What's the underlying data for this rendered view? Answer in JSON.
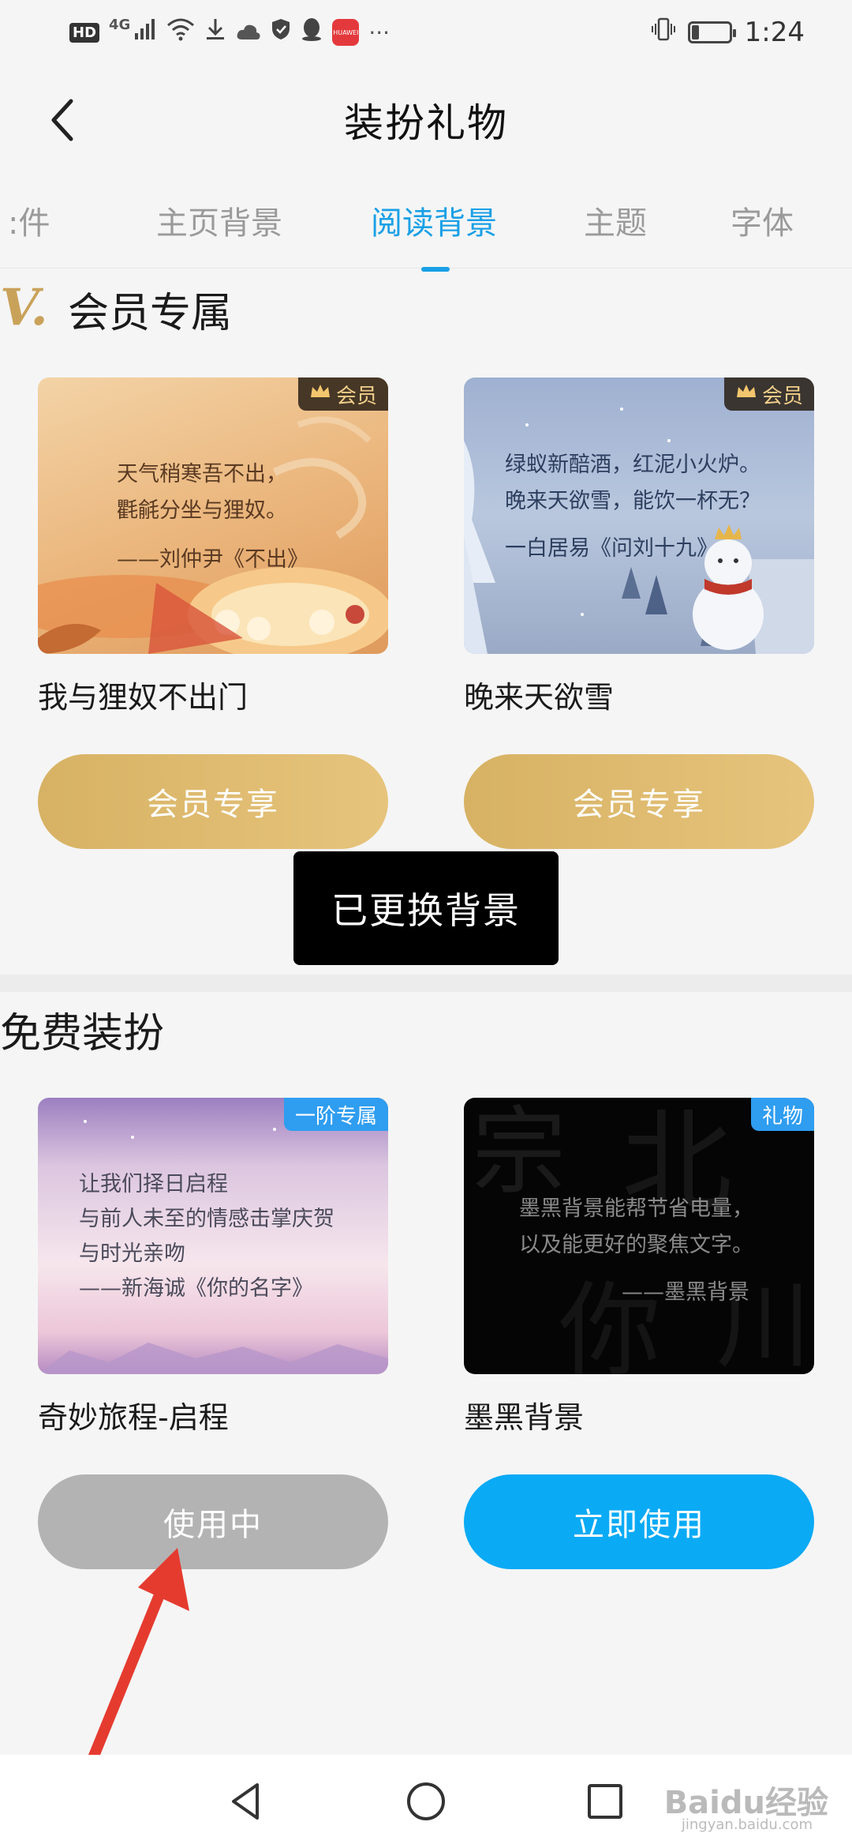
{
  "status_bar": {
    "hd": "HD",
    "network": "4G",
    "huawei_badge": "HUAWEI",
    "more": "···",
    "time": "1:24",
    "battery_level": 0.2
  },
  "header": {
    "title": "装扮礼物"
  },
  "tabs": [
    {
      "label": "挂件",
      "visible_label": ":件"
    },
    {
      "label": "主页背景"
    },
    {
      "label": "阅读背景",
      "active": true
    },
    {
      "label": "主题"
    },
    {
      "label": "字体"
    }
  ],
  "vip_section": {
    "logo": "V.",
    "title": "会员专属",
    "cards": [
      {
        "badge": "会员",
        "poem_lines": [
          "天气稍寒吾不出，",
          "氍毹分坐与狸奴。",
          "——刘仲尹《不出》"
        ],
        "name": "我与狸奴不出门",
        "button": "会员专享"
      },
      {
        "badge": "会员",
        "poem_lines": [
          "绿蚁新醅酒，红泥小火炉。",
          "晚来天欲雪，能饮一杯无？",
          "一白居易《问刘十九》"
        ],
        "name": "晚来天欲雪",
        "button": "会员专享"
      }
    ]
  },
  "toast": "已更换背景",
  "free_section": {
    "title": "免费装扮",
    "cards": [
      {
        "badge": "一阶专属",
        "poem_lines": [
          "让我们择日启程",
          "与前人未至的情感击掌庆贺",
          "与时光亲吻",
          "——新海诚《你的名字》"
        ],
        "name": "奇妙旅程-启程",
        "button": "使用中"
      },
      {
        "badge": "礼物",
        "poem_lines": [
          "墨黑背景能帮节省电量，",
          "以及能更好的聚焦文字。",
          "——墨黑背景"
        ],
        "name": "墨黑背景",
        "button": "立即使用"
      }
    ]
  },
  "watermark": {
    "brand": "Baidu经验",
    "url": "jingyan.baidu.com"
  },
  "colors": {
    "accent": "#1aa0e6",
    "gold": "#d7b264",
    "gray_button": "#b3b3b3",
    "blue_button": "#0aaaf5",
    "arrow": "#e53b2f"
  }
}
